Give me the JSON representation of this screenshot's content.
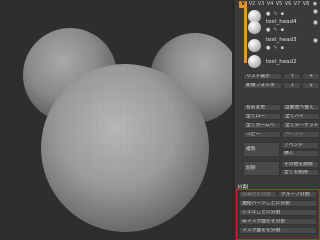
{
  "version_tabs": [
    "V",
    "V2",
    "V3",
    "V4",
    "V5",
    "V6",
    "V7",
    "V8"
  ],
  "version_tab_active_index": 0,
  "subtools": [
    {
      "name": "test_head4"
    },
    {
      "name": "test_head3"
    },
    {
      "name": "test_head2"
    }
  ],
  "list_panel": {
    "list_show_label": "リスト表示",
    "new_folder_label": "新規フォルダ"
  },
  "buttons": {
    "rename": "名前変更",
    "auto_reorder": "自動並べ替え",
    "all_low": "全てロー",
    "all_high": "全てハイ",
    "all_home": "全てホームへ",
    "all_target": "全てターゲットへ",
    "copy": "コピー",
    "paste": "ペースト",
    "duplicate": "複製",
    "append": "アペンド",
    "insert": "挿入",
    "delete": "削除",
    "delete_others": "その他を削除",
    "delete_all": "全てを削除"
  },
  "split": {
    "section_label": "分割",
    "split_hidden": "非表示を分割",
    "group_split": "グループ分割",
    "split_unlinked": "連結パーツごとに分割",
    "split_by_shell": "シェルごとに分割",
    "split_by_mask": "非マスク面をを分割",
    "mask_split": "マスク面をを分割"
  },
  "colors": {
    "accent": "#e8912d",
    "highlight_box": "#e11d1d",
    "panel_bg": "#3a3a3a",
    "viewport_bg": "#2e2e2e"
  }
}
